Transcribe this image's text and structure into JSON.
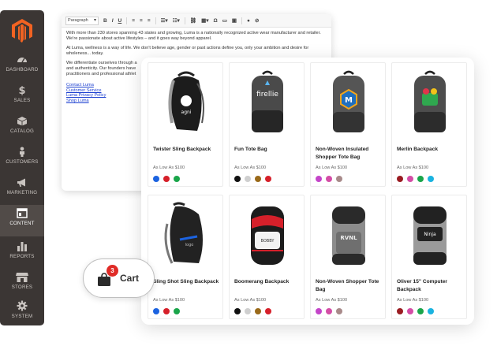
{
  "sidebar": {
    "logo": "magento-logo",
    "items": [
      {
        "label": "Dashboard",
        "icon": "speedometer-icon"
      },
      {
        "label": "Sales",
        "icon": "dollar-icon"
      },
      {
        "label": "Catalog",
        "icon": "cube-icon"
      },
      {
        "label": "Customers",
        "icon": "person-icon"
      },
      {
        "label": "Marketing",
        "icon": "megaphone-icon"
      },
      {
        "label": "Content",
        "icon": "layout-icon",
        "active": true
      },
      {
        "label": "Reports",
        "icon": "bar-chart-icon"
      },
      {
        "label": "Stores",
        "icon": "storefront-icon"
      },
      {
        "label": "System",
        "icon": "gear-icon"
      }
    ]
  },
  "editor": {
    "format_select": "Paragraph",
    "paragraphs": [
      "With more than 230 stores spanning 43 states and growing, Luma is a nationally recognized active wear manufacturer and retailer. We're passionate about active lifestyles – and it goes way beyond apparel.",
      "At Luma, wellness is a way of life. We don't believe age, gender or past actions define you, only your ambition and desire for wholeness... today.",
      "We differentiate ourselves through a and authenticity. Our founders have practitioners and professional athlet"
    ],
    "links": [
      "Contact Luma",
      "Customer Service",
      "Luma Privacy Policy",
      "Shop Luma"
    ]
  },
  "products": [
    {
      "name": "Twister Sling Backpack",
      "price": "As Low As $100",
      "swatches": [
        "#1c63e0",
        "#d6202a",
        "#1aa54a"
      ]
    },
    {
      "name": "Fun Tote Bag",
      "price": "As Low As $100",
      "swatches": [
        "#111111",
        "#cfcfcf",
        "#9a6a1a",
        "#d6202a"
      ]
    },
    {
      "name": "Non-Woven Insulated Shopper Tote Bag",
      "price": "As Low As $100",
      "swatches": [
        "#c445c9",
        "#d44da6",
        "#a88a8a"
      ]
    },
    {
      "name": "Merlin Backpack",
      "price": "As Low As $100",
      "swatches": [
        "#9a1c22",
        "#d44da6",
        "#1aa54a",
        "#1ab3e0"
      ]
    },
    {
      "name": "Sling Shot Sling Backpack",
      "price": "As Low As $100",
      "swatches": [
        "#1c63e0",
        "#d6202a",
        "#1aa54a"
      ]
    },
    {
      "name": "Boomerang Backpack",
      "price": "As Low As $100",
      "swatches": [
        "#111111",
        "#cfcfcf",
        "#9a6a1a",
        "#d6202a"
      ]
    },
    {
      "name": "Non-Woven Shopper Tote Bag",
      "price": "As Low As $100",
      "swatches": [
        "#c445c9",
        "#d44da6",
        "#a88a8a"
      ]
    },
    {
      "name": "Oliver 15\" Computer Backpack",
      "price": "As Low As $100",
      "swatches": [
        "#9a1c22",
        "#d44da6",
        "#1aa54a",
        "#1ab3e0"
      ]
    }
  ],
  "cart": {
    "label": "Cart",
    "count": "3"
  }
}
